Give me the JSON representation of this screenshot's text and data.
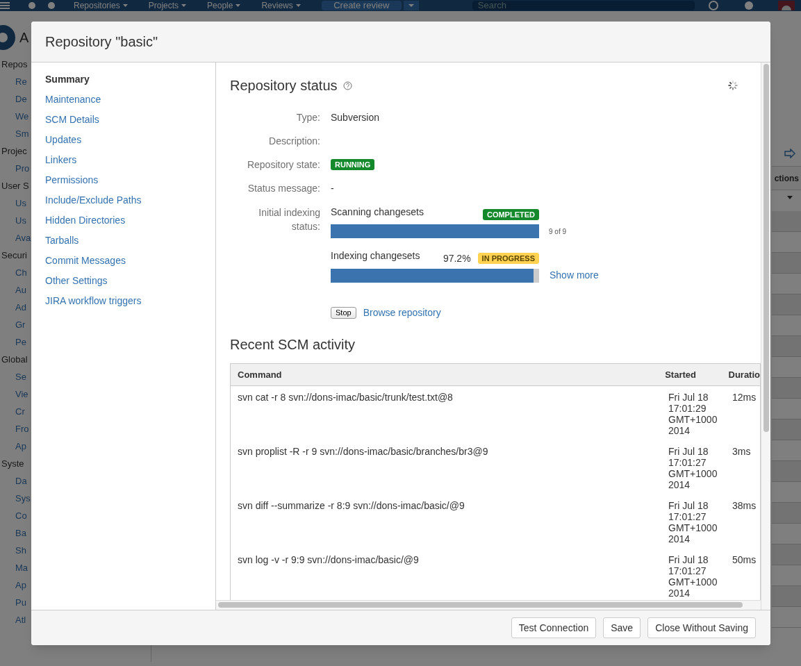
{
  "background": {
    "navbar": {
      "menus": [
        "Repositories",
        "Projects",
        "People",
        "Reviews"
      ],
      "create_button": "Create review",
      "search": {
        "placeholder": "Search"
      }
    },
    "app_letter": "A",
    "sidebar": [
      {
        "kind": "heading",
        "label": "Repos"
      },
      {
        "kind": "item",
        "label": "Re"
      },
      {
        "kind": "item",
        "label": "De"
      },
      {
        "kind": "item",
        "label": "We"
      },
      {
        "kind": "item",
        "label": "Sm"
      },
      {
        "kind": "heading",
        "label": "Projec"
      },
      {
        "kind": "item",
        "label": "Pro"
      },
      {
        "kind": "heading",
        "label": "User S"
      },
      {
        "kind": "item",
        "label": "Us"
      },
      {
        "kind": "item",
        "label": "Us"
      },
      {
        "kind": "item",
        "label": "Ava"
      },
      {
        "kind": "heading",
        "label": "Securi"
      },
      {
        "kind": "item",
        "label": "Ch"
      },
      {
        "kind": "item",
        "label": "Au"
      },
      {
        "kind": "item",
        "label": "Ad"
      },
      {
        "kind": "item",
        "label": "Gr"
      },
      {
        "kind": "item",
        "label": "Pe"
      },
      {
        "kind": "heading",
        "label": "Global"
      },
      {
        "kind": "item",
        "label": "Se"
      },
      {
        "kind": "item",
        "label": "Vie"
      },
      {
        "kind": "item",
        "label": "Cr"
      },
      {
        "kind": "item",
        "label": "Fro"
      },
      {
        "kind": "item",
        "label": "Ap"
      },
      {
        "kind": "heading",
        "label": "Syste"
      },
      {
        "kind": "item",
        "label": "Da"
      },
      {
        "kind": "item",
        "label": "Sys"
      },
      {
        "kind": "item",
        "label": "Co"
      },
      {
        "kind": "item",
        "label": "Ba"
      },
      {
        "kind": "item",
        "label": "Sh"
      },
      {
        "kind": "item",
        "label": "Ma"
      },
      {
        "kind": "item",
        "label": "Ap"
      },
      {
        "kind": "item",
        "label": "Pu"
      },
      {
        "kind": "item",
        "label": "Atl"
      }
    ],
    "table_header_fragment": "ctions"
  },
  "dialog": {
    "title": "Repository \"basic\"",
    "nav": [
      {
        "label": "Summary",
        "selected": true
      },
      {
        "label": "Maintenance",
        "selected": false
      },
      {
        "label": "SCM Details",
        "selected": false
      },
      {
        "label": "Updates",
        "selected": false
      },
      {
        "label": "Linkers",
        "selected": false
      },
      {
        "label": "Permissions",
        "selected": false
      },
      {
        "label": "Include/Exclude Paths",
        "selected": false
      },
      {
        "label": "Hidden Directories",
        "selected": false
      },
      {
        "label": "Tarballs",
        "selected": false
      },
      {
        "label": "Commit Messages",
        "selected": false
      },
      {
        "label": "Other Settings",
        "selected": false
      },
      {
        "label": "JIRA workflow triggers",
        "selected": false
      }
    ],
    "status": {
      "heading": "Repository status",
      "fields": [
        {
          "label": "Type:",
          "kind": "text",
          "value": "Subversion"
        },
        {
          "label": "Description:",
          "kind": "text"
        },
        {
          "label": "Repository state:",
          "kind": "badge",
          "badge": {
            "text": "RUNNING",
            "kind": "success"
          }
        },
        {
          "label": "Status message:",
          "kind": "text",
          "value": "-"
        }
      ],
      "indexing": {
        "label": "Initial indexing status:",
        "tasks": [
          {
            "name": "Scanning changesets",
            "badge": {
              "text": "COMPLETED",
              "kind": "success"
            },
            "level": 1,
            "count": "9 of 9"
          },
          {
            "name": "Indexing changesets",
            "percent": "97.2%",
            "badge": {
              "text": "IN PROGRESS",
              "kind": "warning"
            },
            "level": 0.972,
            "link": "Show more"
          }
        ]
      },
      "stop_button": "Stop",
      "browse_link": "Browse repository"
    },
    "activity": {
      "heading": "Recent SCM activity",
      "columns": [
        "Command",
        "Started",
        "Duratio"
      ],
      "rows": [
        [
          "svn cat -r 8 svn://dons-imac/basic/trunk/test.txt@8",
          "Fri Jul 18 17:01:29 GMT+1000 2014",
          "12ms"
        ],
        [
          "svn proplist -R -r 9 svn://dons-imac/basic/branches/br3@9",
          "Fri Jul 18 17:01:27 GMT+1000 2014",
          "3ms"
        ],
        [
          "svn diff --summarize -r 8:9 svn://dons-imac/basic/@9",
          "Fri Jul 18 17:01:27 GMT+1000 2014",
          "38ms"
        ],
        [
          "svn log -v -r 9:9 svn://dons-imac/basic/@9",
          "Fri Jul 18 17:01:27 GMT+1000 2014",
          "50ms"
        ]
      ]
    },
    "buttons": [
      "Test Connection",
      "Save",
      "Close Without Saving"
    ]
  }
}
